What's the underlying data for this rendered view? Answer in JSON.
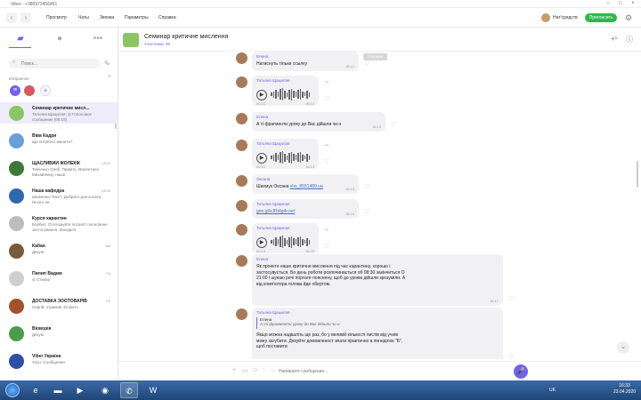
{
  "window": {
    "title": "Viber - +380973456451"
  },
  "topbar": {
    "menus": [
      "Просмотр",
      "Чаты",
      "Звонки",
      "Параметры",
      "Справка"
    ],
    "user_name": "Нат'средств",
    "invite_label": "Пригласить"
  },
  "sidebar": {
    "search_placeholder": "Поиск...",
    "favorites_label": "Избранное",
    "chats": [
      {
        "name": "Семинар критичне мисл...",
        "preview": "Татьяна Щацилая: ◎ Голосовое сообщение (00:19)",
        "time": "",
        "color": "#8ac763"
      },
      {
        "name": "Віва Кадри",
        "preview": "Ще потрібно змінити?",
        "time": "",
        "color": "#6aa0d8"
      },
      {
        "name": "ЩАСЛИВИЙ ЖОЛЕКІК",
        "preview": "Ткаченко Олеб: Привіть, Валентино Михайлівну, наше",
        "time": "13:11",
        "color": "#3b7a3b"
      },
      {
        "name": "Наша кафедра",
        "preview": "Шевченко Текст: Добрато дня колеги. Нічого не",
        "time": "13:00",
        "color": "#2f67b1"
      },
      {
        "name": "Курси карантин",
        "preview": "Борбел: Оголошуйте потрапт посилання застосування. Заходьте",
        "time": "",
        "color": "#bdbdbd"
      },
      {
        "name": "Кабан",
        "preview": "Дякую.",
        "time": "Sat",
        "color": "#7a5a3a"
      },
      {
        "name": "Пилип Вадим",
        "preview": "◎ Стикер",
        "time": "Fri",
        "color": "#cfcfcf"
      },
      {
        "name": "ДОСТАВКА ЗООТОВАРІВ",
        "preview": "Сергій: отримав 4З фото",
        "time": "Fri",
        "color": "#a0522d"
      },
      {
        "name": "Віоворія",
        "preview": "Дякую",
        "time": "",
        "color": "#4a9c4a"
      },
      {
        "name": "Viber Україна",
        "preview": "Yoyu: Сообщения",
        "time": "",
        "color": "#2e4fa8"
      }
    ]
  },
  "chat": {
    "title": "Семинар критичне мислення",
    "subtitle": "Участники: 35",
    "date_pill": "Сегодня",
    "messages": [
      {
        "sender": "Елена",
        "text": "Натиснуть тільки ссылку",
        "time": "16:12"
      },
      {
        "sender": "Татьяна Щацилая",
        "type": "voice",
        "duration": "00:22",
        "time": "16:12"
      },
      {
        "sender": "Елена",
        "text": "А ті фрагменти уроку до Вас дійшли чи н",
        "time": "16:13"
      },
      {
        "sender": "Татьяна Щацилая",
        "type": "voice",
        "duration": "00:22",
        "time": "16:13"
      },
      {
        "sender": "Оксана",
        "text": "Шахмук Оксана",
        "link": "vhs_8551489.ua",
        "time": "16:13"
      },
      {
        "sender": "Татьяна Щацилая",
        "text": "",
        "link": "goo.gl/sJRt4g4r.net",
        "time": "16:14"
      },
      {
        "sender": "Татьяна Щацилая",
        "type": "voice",
        "duration": "00:14",
        "time": "16:16"
      },
      {
        "sender": "Елена",
        "text": "Як проекте наше критичне мислення під час карантину, хорошо і застосувується. Бо день роботи розпочинається об 08:30 закінчиться О 21:00 і шукаю речі портате пояснену, щоб до уроків дійшли зрозуміли. А від комп'ютера голова йде обертом.",
        "time": "16:17"
      },
      {
        "sender": "Татьяна Щацилая",
        "quote_sender": "Елена",
        "quote_text": "А ті фрагменти уроку до Вас дійшли чи н",
        "text": "Якщо можна надішліть ще раз, бо у великій кількості листів від учнів можу загубити. Дякуйте домовленост вчати практично в понеділок \"Б\", щоб поставити",
        "time": ""
      }
    ],
    "composer_placeholder": "Напишите сообщение..."
  },
  "taskbar": {
    "lang": "UK",
    "time": "16:33",
    "date": "23.04.2020"
  }
}
